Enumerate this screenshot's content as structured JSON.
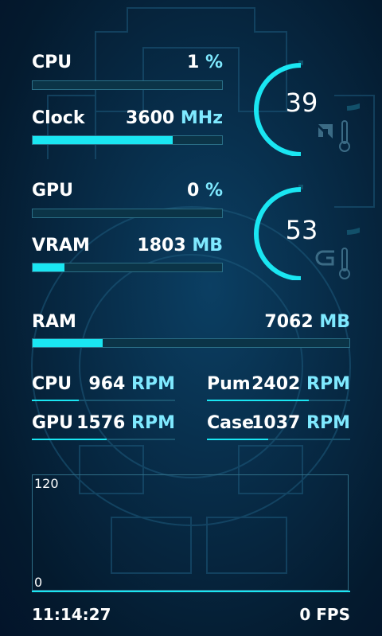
{
  "cpu": {
    "label": "CPU",
    "value": "1",
    "unit": "%",
    "level": 0.0
  },
  "clock": {
    "label": "Clock",
    "value": "3600",
    "unit": "MHz",
    "level": 0.74
  },
  "gpu": {
    "label": "GPU",
    "value": "0",
    "unit": "%",
    "level": 0.0
  },
  "vram": {
    "label": "VRAM",
    "value": "1803",
    "unit": "MB",
    "level": 0.17
  },
  "ram": {
    "label": "RAM",
    "value": "7062",
    "unit": "MB",
    "level": 0.22
  },
  "cpu_temp": {
    "value": "39",
    "icon": "amd-logo-icon"
  },
  "gpu_temp": {
    "value": "53",
    "icon": "gpu-logo-icon"
  },
  "fans": {
    "cpu": {
      "label": "CPU",
      "value": "964",
      "unit": "RPM",
      "level": 0.33
    },
    "pump": {
      "label": "Pum",
      "value": "2402",
      "unit": "RPM",
      "level": 0.71
    },
    "gpu": {
      "label": "GPU",
      "value": "1576",
      "unit": "RPM",
      "level": 0.52
    },
    "case": {
      "label": "Case",
      "value": "1037",
      "unit": "RPM",
      "level": 0.43
    }
  },
  "graph": {
    "max_label": "120",
    "min_label": "0"
  },
  "footer": {
    "time": "11:14:27",
    "fps": "0 FPS"
  },
  "colors": {
    "accent": "#1ae6f2",
    "bg": "#072a45"
  }
}
